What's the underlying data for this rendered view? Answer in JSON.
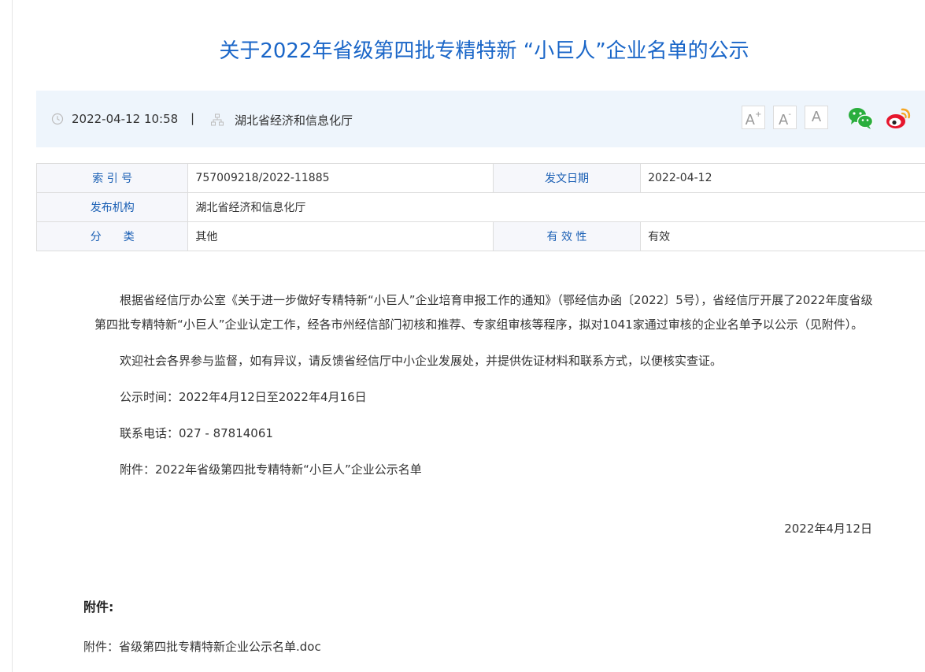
{
  "title": "关于2022年省级第四批专精特新 “小巨人”企业名单的公示",
  "meta": {
    "date": "2022-04-12 10:58",
    "separator": "|",
    "org": "湖北省经济和信息化厅",
    "font_large": "A",
    "font_large_sup": "+",
    "font_small": "A",
    "font_small_sup": "-",
    "font_normal": "A",
    "clock_icon": "clock-icon",
    "org_icon": "org-chart-icon",
    "wechat_icon": "wechat-icon",
    "weibo_icon": "weibo-icon",
    "colors": {
      "title": "#1a66c8",
      "meta_bg": "#eef5fc",
      "label": "#1a5fb4",
      "wechat": "#2aae3d",
      "weibo": "#e6162d"
    }
  },
  "info": {
    "index_label": "索 引 号",
    "index_value": "757009218/2022-11885",
    "date_label": "发文日期",
    "date_value": "2022-04-12",
    "issuer_label": "发布机构",
    "issuer_value": "湖北省经济和信息化厅",
    "category_label": "分　　类",
    "category_value": "其他",
    "validity_label": "有 效 性",
    "validity_value": "有效"
  },
  "content": {
    "p1": "根据省经信厅办公室《关于进一步做好专精特新“小巨人”企业培育申报工作的通知》（鄂经信办函〔2022〕5号），省经信厅开展了2022年度省级第四批专精特新“小巨人”企业认定工作，经各市州经信部门初核和推荐、专家组审核等程序，拟对1041家通过审核的企业名单予以公示（见附件）。",
    "p2": "欢迎社会各界参与监督，如有异议，请反馈省经信厅中小企业发展处，并提供佐证材料和联系方式，以便核实查证。",
    "p3": "公示时间：2022年4月12日至2022年4月16日",
    "p4": "联系电话：027 - 87814061",
    "p5": "附件：2022年省级第四批专精特新“小巨人”企业公示名单",
    "sign_date": "2022年4月12日"
  },
  "attachments": {
    "heading": "附件:",
    "item_prefix": "附件：",
    "item_name": "省级第四批专精特新企业公示名单.doc"
  }
}
